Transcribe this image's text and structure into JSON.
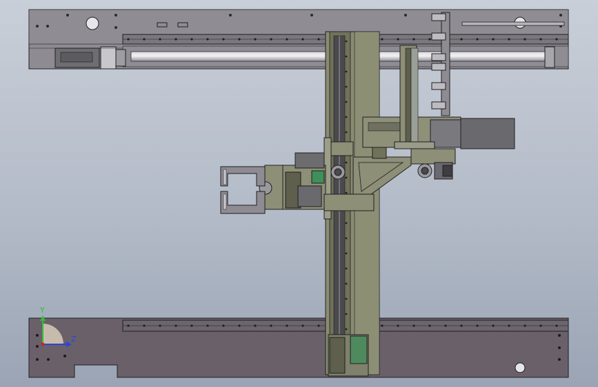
{
  "triad": {
    "y_label": "Y",
    "z_label": "Z",
    "y_color": "#2fbf3a",
    "z_color": "#2a46d8"
  },
  "colors": {
    "plate": "#8d8b90",
    "plate_dark": "#6e6570",
    "rail": "#7d7b80",
    "olive": "#8c8e74",
    "olive_dark": "#6d7058",
    "motor": "#6f6f72",
    "line": "#1e1e22",
    "green_accent": "#3f8f5a"
  }
}
